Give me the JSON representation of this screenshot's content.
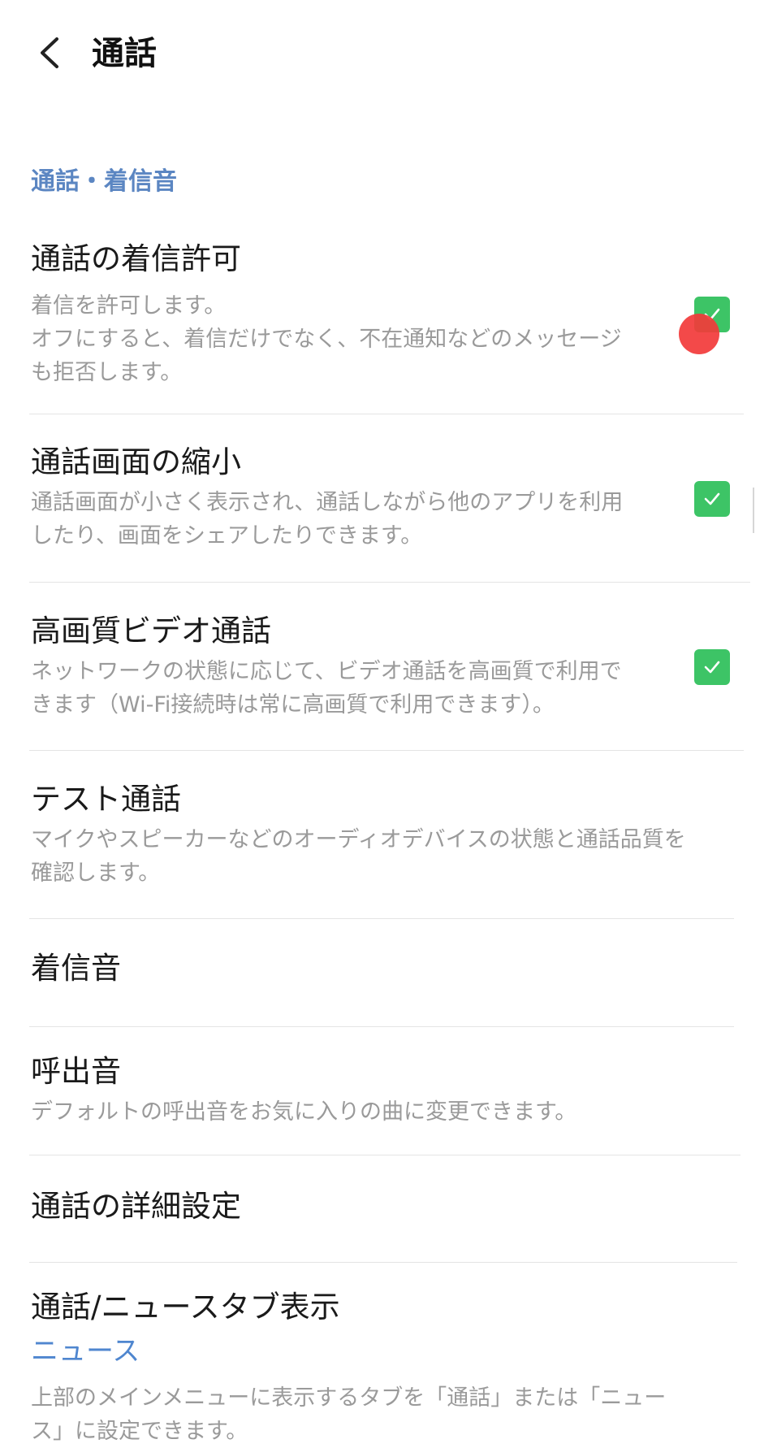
{
  "header": {
    "back_icon": "chevron-left-icon",
    "title": "通話"
  },
  "section": {
    "title": "通話・着信音"
  },
  "colors": {
    "accent_blue": "#5b86c2",
    "link_blue": "#4f86cf",
    "checkbox_green": "#3dc466",
    "touch_indicator": "#f23a3a"
  },
  "items": [
    {
      "title": "通話の着信許可",
      "description_lines": [
        "着信を許可します。",
        "オフにすると、着信だけでなく、不在通知などのメッセージ",
        "も拒否します。"
      ],
      "checked": true
    },
    {
      "title": "通話画面の縮小",
      "description_lines": [
        "通話画面が小さく表示され、通話しながら他のアプリを利用",
        "したり、画面をシェアしたりできます。"
      ],
      "checked": true
    },
    {
      "title": "高画質ビデオ通話",
      "description_lines": [
        "ネットワークの状態に応じて、ビデオ通話を高画質で利用で",
        "きます（Wi-Fi接続時は常に高画質で利用できます）。"
      ],
      "checked": true
    },
    {
      "title": "テスト通話",
      "description_lines": [
        "マイクやスピーカーなどのオーディオデバイスの状態と通話品質を",
        "確認します。"
      ]
    },
    {
      "title": "着信音"
    },
    {
      "title": "呼出音",
      "description_lines": [
        "デフォルトの呼出音をお気に入りの曲に変更できます。"
      ]
    },
    {
      "title": "通話の詳細設定"
    },
    {
      "title": "通話/ニュースタブ表示",
      "value": "ニュース",
      "description_lines": [
        "上部のメインメニューに表示するタブを「通話」または「ニュー",
        "ス」に設定できます。"
      ]
    }
  ]
}
